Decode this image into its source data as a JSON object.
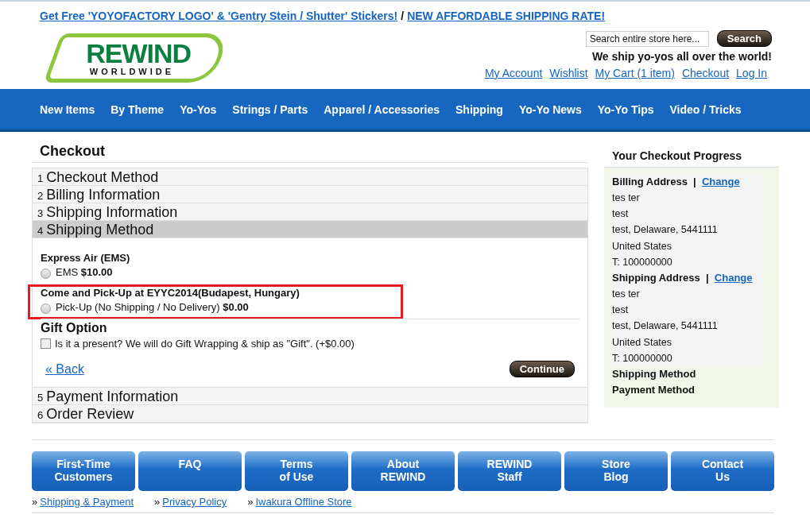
{
  "promo": {
    "links": [
      "Get Free 'YOYOFACTORY LOGO' & 'Gentry Stein / Shutter' Stickers!",
      "NEW AFFORDABLE SHIPPING RATE!"
    ],
    "separator": "/"
  },
  "logo": {
    "word": "REWIND",
    "sub": "WORLDWIDE"
  },
  "search": {
    "placeholder": "Search entire store here...",
    "button": "Search"
  },
  "tagline": "We ship yo-yos all over the world!",
  "account_links": [
    "My Account",
    "Wishlist",
    "My Cart (1 item)",
    "Checkout",
    "Log In"
  ],
  "nav": [
    "New Items",
    "By Theme",
    "Yo-Yos",
    "Strings / Parts",
    "Apparel / Accessories",
    "Shipping",
    "Yo-Yo News",
    "Yo-Yo Tips",
    "Video / Tricks"
  ],
  "page_title": "Checkout",
  "steps": [
    {
      "number": "1",
      "title": "Checkout Method",
      "active": false
    },
    {
      "number": "2",
      "title": "Billing Information",
      "active": false
    },
    {
      "number": "3",
      "title": "Shipping Information",
      "active": false
    },
    {
      "number": "4",
      "title": "Shipping Method",
      "active": true
    },
    {
      "number": "5",
      "title": "Payment Information",
      "active": false
    },
    {
      "number": "6",
      "title": "Order Review",
      "active": false
    }
  ],
  "shipping_options": [
    {
      "group": "Express Air (EMS)",
      "label": "EMS",
      "price": "$10.00",
      "selected": false,
      "highlighted": false
    },
    {
      "group": "Come and Pick-Up at EYYC2014(Budapest, Hungary)",
      "label": "Pick-Up (No Shipping / No Delivery)",
      "price": "$0.00",
      "selected": false,
      "highlighted": true
    }
  ],
  "gift": {
    "title": "Gift Option",
    "label": "Is it a present? We will do Gift Wrapping & ship as \"Gift\". (+$0.00)",
    "checked": false
  },
  "back_link": "« Back",
  "continue_button": "Continue",
  "progress": {
    "title": "Your Checkout Progress",
    "sections": [
      {
        "title": "Billing Address",
        "separator": "|",
        "link": "Change",
        "lines": [
          "tes ter",
          "test",
          "test, Delaware, 5441111",
          "United States",
          "T: 100000000"
        ]
      },
      {
        "title": "Shipping Address",
        "separator": "|",
        "link": "Change",
        "lines": [
          "tes ter",
          "test",
          "test, Delaware, 5441111",
          "United States",
          "T: 100000000"
        ]
      },
      {
        "title": "Shipping Method"
      },
      {
        "title": "Payment Method"
      }
    ]
  },
  "footer_buttons": [
    "First-Time\nCustomers",
    "FAQ",
    "Terms\nof Use",
    "About\nREWIND",
    "REWIND\nStaff",
    "Store\nBlog",
    "Contact\nUs"
  ],
  "footer_links": [
    {
      "bullet": "»",
      "label": "Shipping & Payment"
    },
    {
      "bullet": "»",
      "label": "Privacy Policy"
    },
    {
      "bullet": "»",
      "label": "Iwakura Offline Store"
    }
  ]
}
